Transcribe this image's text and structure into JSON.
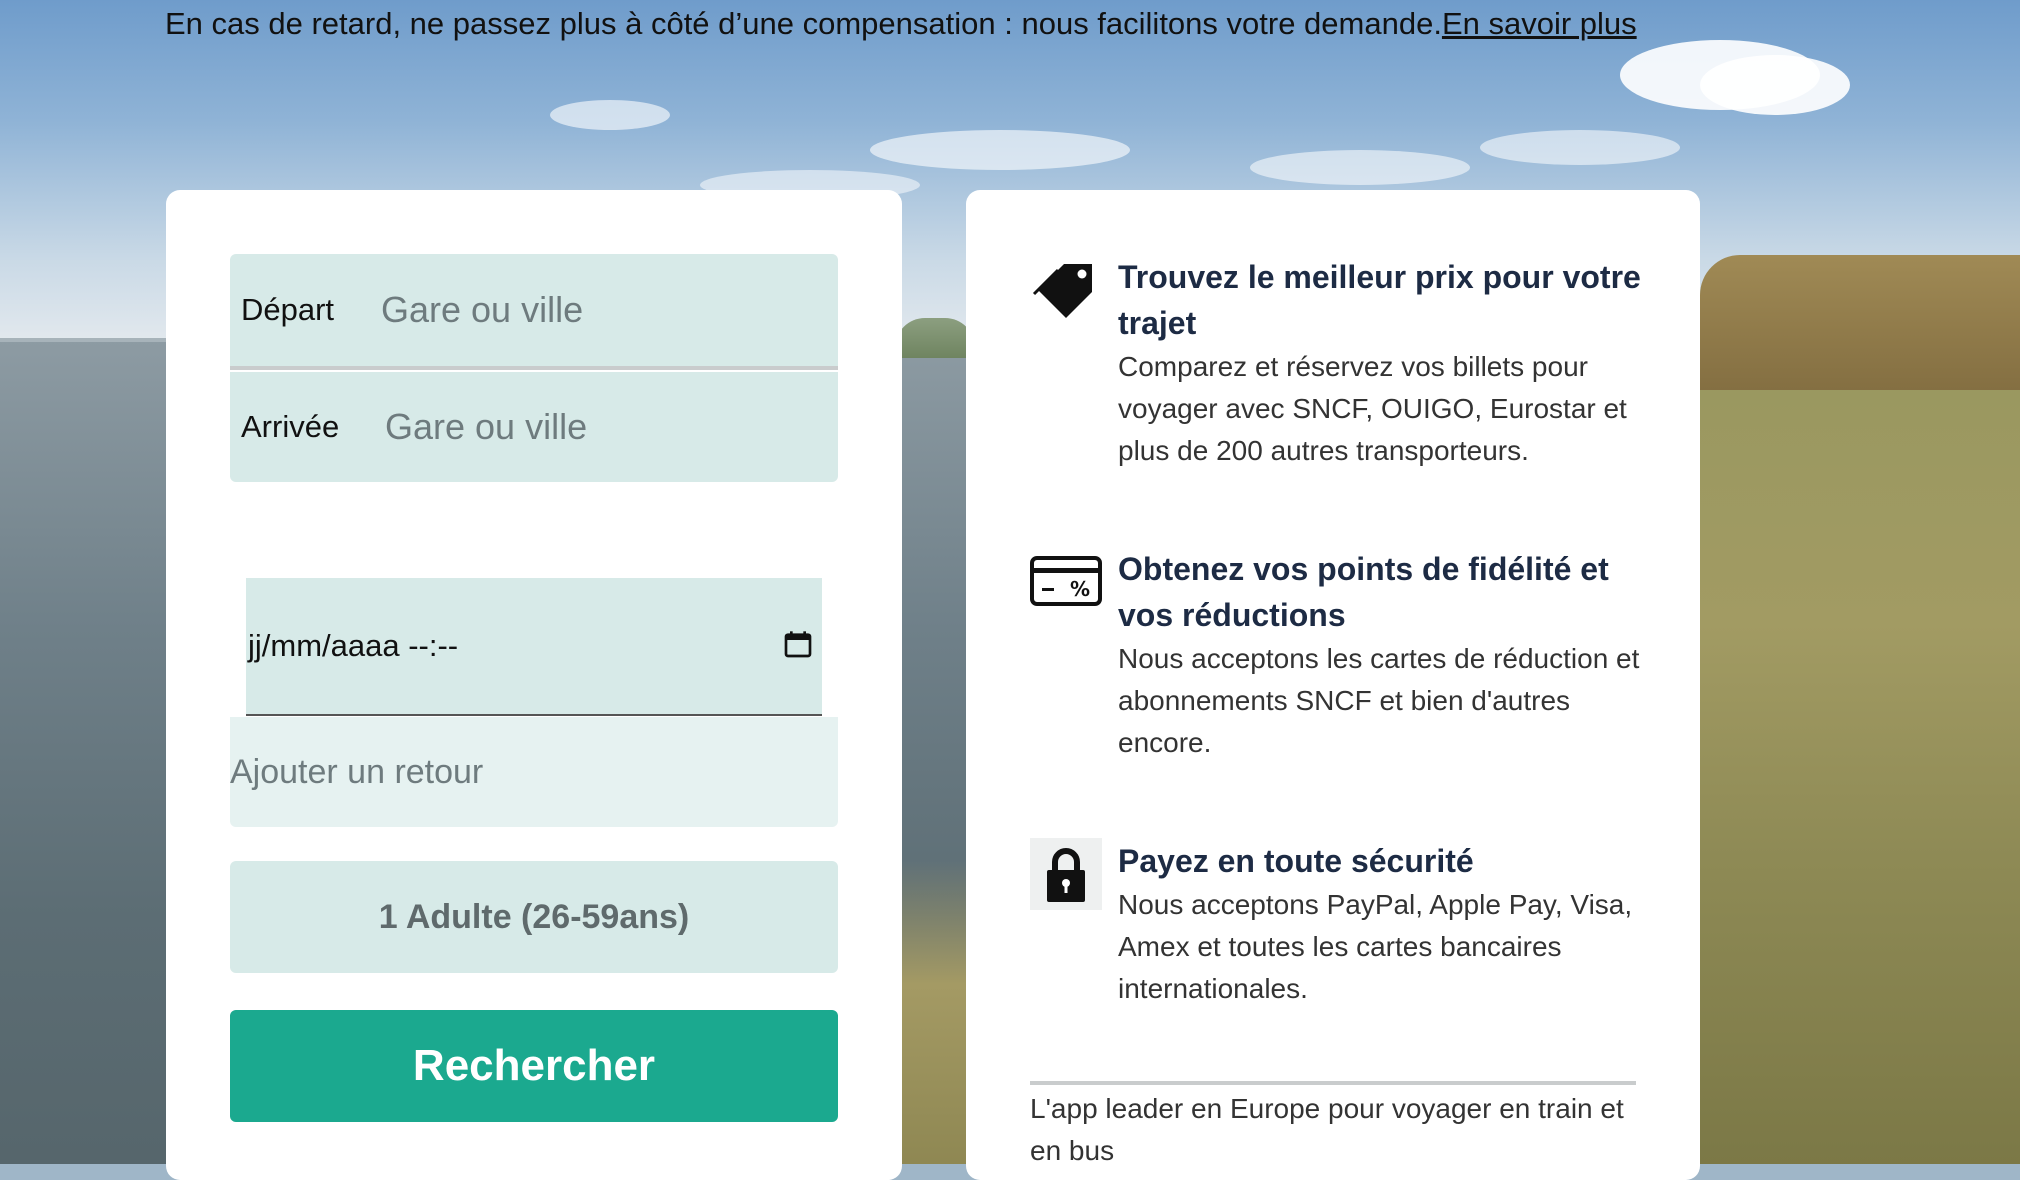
{
  "banner": {
    "text": "En cas de retard, ne passez plus à côté d’une compensation : nous facilitons votre demande.",
    "link": "En savoir plus"
  },
  "search": {
    "depart_label": "Départ",
    "depart_placeholder": "Gare ou ville",
    "arrivee_label": "Arrivée",
    "arrivee_placeholder": "Gare ou ville",
    "date_value": "jj/mm/aaaa  --:--",
    "retour_label": "Ajouter un retour",
    "passengers": "1 Adulte (26-59ans)",
    "submit_label": "Rechercher"
  },
  "features": [
    {
      "icon": "price-tag-icon",
      "title": "Trouvez le meilleur prix pour votre trajet",
      "text": "Comparez et réservez vos billets pour voyager avec SNCF, OUIGO, Eurostar et plus de 200 autres transporteurs."
    },
    {
      "icon": "discount-card-icon",
      "title": "Obtenez vos points de fidélité et vos réductions",
      "text": "Nous acceptons les cartes de réduction et abonnements SNCF et bien d'autres encore."
    },
    {
      "icon": "padlock-icon",
      "title": "Payez en toute sécurité",
      "text": "Nous acceptons PayPal, Apple Pay, Visa, Amex et toutes les cartes bancaires internationales."
    }
  ],
  "footer_text": "L'app leader en Europe pour voyager en train et en bus"
}
